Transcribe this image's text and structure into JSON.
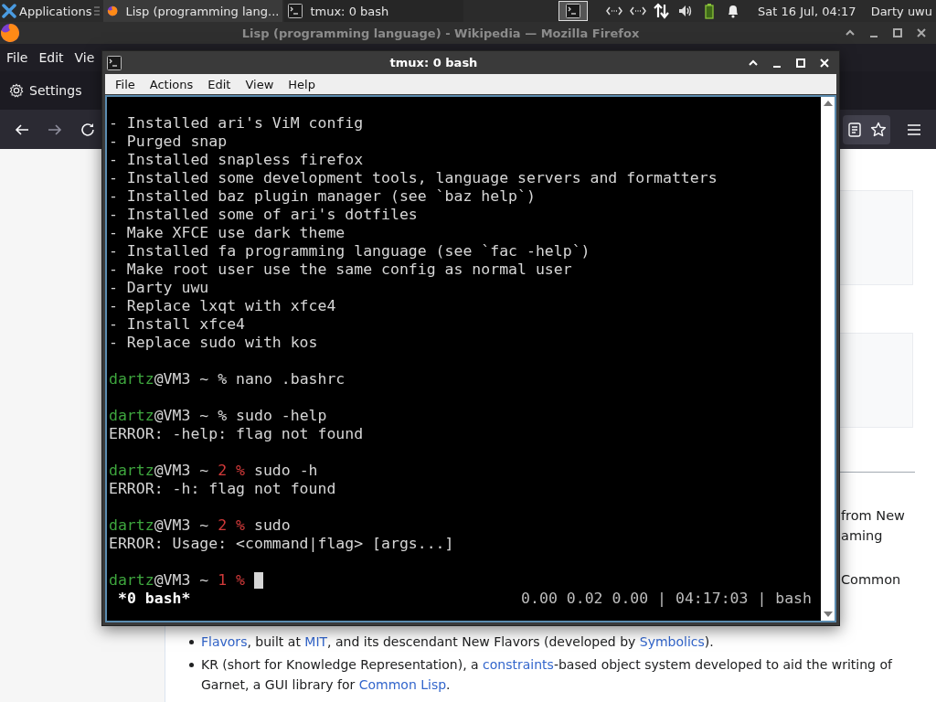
{
  "panel": {
    "applications": "Applications",
    "tasks": [
      {
        "label": "Lisp (programming lang...",
        "kind": "browser",
        "selected": false
      },
      {
        "label": "tmux: 0 bash",
        "kind": "terminal",
        "selected": true
      }
    ],
    "clock": "Sat 16 Jul, 04:17",
    "user": "Darty uwu"
  },
  "browser": {
    "title": "Lisp (programming language) - Wikipedia — Mozilla Firefox",
    "menu": [
      "File",
      "Edit",
      "Vie"
    ],
    "bookmark": "Settings",
    "fragments": [
      "from New",
      "aming",
      "Common"
    ],
    "bullets": [
      {
        "segments": [
          {
            "text": "Flavors",
            "kind": "link"
          },
          {
            "text": ", built at ",
            "kind": "plain"
          },
          {
            "text": "MIT",
            "kind": "link"
          },
          {
            "text": ", and its descendant New Flavors (developed by ",
            "kind": "plain"
          },
          {
            "text": "Symbolics",
            "kind": "link"
          },
          {
            "text": ").",
            "kind": "plain"
          }
        ]
      },
      {
        "segments": [
          {
            "text": "KR (short for Knowledge Representation), a ",
            "kind": "plain"
          },
          {
            "text": "constraints",
            "kind": "link"
          },
          {
            "text": "-based object system developed to aid the writing of Garnet, a GUI library for ",
            "kind": "plain"
          },
          {
            "text": "Common Lisp",
            "kind": "link"
          },
          {
            "text": ".",
            "kind": "plain"
          }
        ]
      }
    ]
  },
  "terminal": {
    "title": "tmux: 0 bash",
    "menu": [
      "File",
      "Actions",
      "Edit",
      "View",
      "Help"
    ],
    "lines": [
      {
        "kind": "output",
        "text": "- Installed ari's ViM config"
      },
      {
        "kind": "output",
        "text": "- Purged snap"
      },
      {
        "kind": "output",
        "text": "- Installed snapless firefox"
      },
      {
        "kind": "output",
        "text": "- Installed some development tools, language servers and formatters"
      },
      {
        "kind": "output",
        "text": "- Installed baz plugin manager (see `baz help`)"
      },
      {
        "kind": "output",
        "text": "- Installed some of ari's dotfiles"
      },
      {
        "kind": "output",
        "text": "- Make XFCE use dark theme"
      },
      {
        "kind": "output",
        "text": "- Installed fa programming language (see `fac -help`)"
      },
      {
        "kind": "output",
        "text": "- Make root user use the same config as normal user"
      },
      {
        "kind": "output",
        "text": "- Darty uwu"
      },
      {
        "kind": "output",
        "text": "- Replace lxqt with xfce4"
      },
      {
        "kind": "output",
        "text": "- Install xfce4"
      },
      {
        "kind": "output",
        "text": "- Replace sudo with kos"
      },
      {
        "kind": "blank"
      },
      {
        "kind": "prompt",
        "user": "dartz",
        "host": "@VM3 ~",
        "symbol": "%",
        "command": "nano .bashrc",
        "cursor": false
      },
      {
        "kind": "blank"
      },
      {
        "kind": "prompt",
        "user": "dartz",
        "host": "@VM3 ~",
        "symbol": "%",
        "command": "sudo -help",
        "cursor": false
      },
      {
        "kind": "output",
        "text": "ERROR: -help: flag not found"
      },
      {
        "kind": "blank"
      },
      {
        "kind": "prompt",
        "user": "dartz",
        "host": "@VM3 ~",
        "code": "2",
        "symbol": "%",
        "command": "sudo -h",
        "cursor": false
      },
      {
        "kind": "output",
        "text": "ERROR: -h: flag not found"
      },
      {
        "kind": "blank"
      },
      {
        "kind": "prompt",
        "user": "dartz",
        "host": "@VM3 ~",
        "code": "2",
        "symbol": "%",
        "command": "sudo",
        "cursor": false
      },
      {
        "kind": "output",
        "text": "ERROR: Usage: <command|flag> [args...]"
      },
      {
        "kind": "blank"
      },
      {
        "kind": "prompt",
        "user": "dartz",
        "host": "@VM3 ~",
        "code": "1",
        "symbol": "%",
        "cursor": true
      }
    ],
    "status_left": "*0 bash*",
    "status_right": "0.00 0.02 0.00 | 04:17:03 | bash"
  }
}
